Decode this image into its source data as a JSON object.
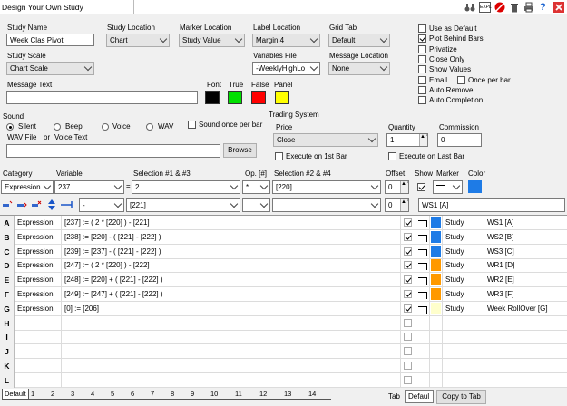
{
  "window": {
    "title": "Design Your Own Study"
  },
  "toolbar": {
    "icons": [
      "binoculars-icon",
      "expl-icon",
      "no-entry-icon",
      "trash-icon",
      "print-icon",
      "help-icon",
      "close-icon"
    ],
    "expl_label": "EXPL",
    "help_label": "?"
  },
  "study": {
    "name_label": "Study Name",
    "name_value": "Week Clas Pivot",
    "location_label": "Study Location",
    "location_value": "Chart",
    "marker_location_label": "Marker Location",
    "marker_location_value": "Study Value",
    "label_location_label": "Label Location",
    "label_location_value": "Margin 4",
    "grid_tab_label": "Grid Tab",
    "grid_tab_value": "Default",
    "scale_label": "Study Scale",
    "scale_value": "Chart Scale",
    "variables_file_label": "Variables File",
    "variables_file_value": "-WeeklyHighLo",
    "message_location_label": "Message Location",
    "message_location_value": "None",
    "message_text_label": "Message Text",
    "message_text_value": ""
  },
  "colors": {
    "labels": [
      "Font",
      "True",
      "False",
      "Panel"
    ],
    "values": [
      "#000000",
      "#00e000",
      "#ff0000",
      "#ffff00"
    ]
  },
  "options": [
    {
      "label": "Use as Default",
      "checked": false
    },
    {
      "label": "Plot Behind Bars",
      "checked": true
    },
    {
      "label": "Privatize",
      "checked": false
    },
    {
      "label": "Close Only",
      "checked": false
    },
    {
      "label": "Show Values",
      "checked": false
    },
    {
      "label": "Email",
      "checked": false
    },
    {
      "label": "Auto Remove",
      "checked": false
    },
    {
      "label": "Auto Completion",
      "checked": false
    }
  ],
  "once_per_bar": {
    "label": "Once per bar",
    "checked": false
  },
  "sound": {
    "label": "Sound",
    "options": [
      "Silent",
      "Beep",
      "Voice",
      "WAV"
    ],
    "selected": "Silent",
    "once_per_bar_label": "Sound once per bar",
    "wav_file_label": "WAV File",
    "or_label": "or",
    "voice_text_label": "Voice Text",
    "browse_label": "Browse"
  },
  "trading": {
    "label": "Trading System",
    "price_label": "Price",
    "price_value": "Close",
    "quantity_label": "Quantity",
    "quantity_value": "1",
    "commission_label": "Commission",
    "commission_value": "0",
    "execute_first_label": "Execute on 1st Bar",
    "execute_last_label": "Execute on Last Bar"
  },
  "editor": {
    "category_label": "Category",
    "variable_label": "Variable",
    "selection13_label": "Selection #1 & #3",
    "op_label": "Op. [#]",
    "selection24_label": "Selection #2 & #4",
    "offset_label": "Offset",
    "show_label": "Show",
    "marker_label": "Marker",
    "color_label": "Color",
    "category_value": "Expression",
    "variable_value": "237",
    "equals": "=",
    "selection1_value": "2",
    "op_value": "*",
    "selection2_value": "[220]",
    "offset_value": "0",
    "color_value": "#1e7be6",
    "row2_sel_value": "-",
    "row2_sel13_value": "[221]",
    "row2_offset_value": "0",
    "name_value": "WS1 [A]"
  },
  "grid": {
    "rows": [
      {
        "id": "A",
        "category": "Expression",
        "formula": "[237] := ( 2 * [220] ) - [221]",
        "show": true,
        "color": "#1e7be6",
        "type": "Study",
        "name": "WS1 [A]"
      },
      {
        "id": "B",
        "category": "Expression",
        "formula": "[238] := [220] - ( [221] - [222] )",
        "show": true,
        "color": "#1e7be6",
        "type": "Study",
        "name": "WS2 [B]"
      },
      {
        "id": "C",
        "category": "Expression",
        "formula": "[239] := [237] - ( [221] - [222] )",
        "show": true,
        "color": "#1e7be6",
        "type": "Study",
        "name": "WS3 [C]"
      },
      {
        "id": "D",
        "category": "Expression",
        "formula": "[247] := ( 2 * [220] ) - [222]",
        "show": true,
        "color": "#ff9900",
        "type": "Study",
        "name": "WR1 [D]"
      },
      {
        "id": "E",
        "category": "Expression",
        "formula": "[248] := [220] + ( [221] - [222] )",
        "show": true,
        "color": "#ff9900",
        "type": "Study",
        "name": "WR2 [E]"
      },
      {
        "id": "F",
        "category": "Expression",
        "formula": "[249] := [247] + ( [221] - [222] )",
        "show": true,
        "color": "#ff9900",
        "type": "Study",
        "name": "WR3 [F]"
      },
      {
        "id": "G",
        "category": "Expression",
        "formula": "[0] := [206]",
        "show": true,
        "color": "#ffffcc",
        "type": "Study",
        "name": "Week RollOver [G]"
      },
      {
        "id": "H"
      },
      {
        "id": "I"
      },
      {
        "id": "J"
      },
      {
        "id": "K"
      },
      {
        "id": "L"
      }
    ]
  },
  "tabs": {
    "items": [
      "Default",
      "1",
      "2",
      "3",
      "4",
      "5",
      "6",
      "7",
      "8",
      "9",
      "10",
      "11",
      "12",
      "13",
      "14"
    ],
    "tab_label": "Tab",
    "tab_value": "Defaul",
    "copy_label": "Copy to Tab"
  }
}
